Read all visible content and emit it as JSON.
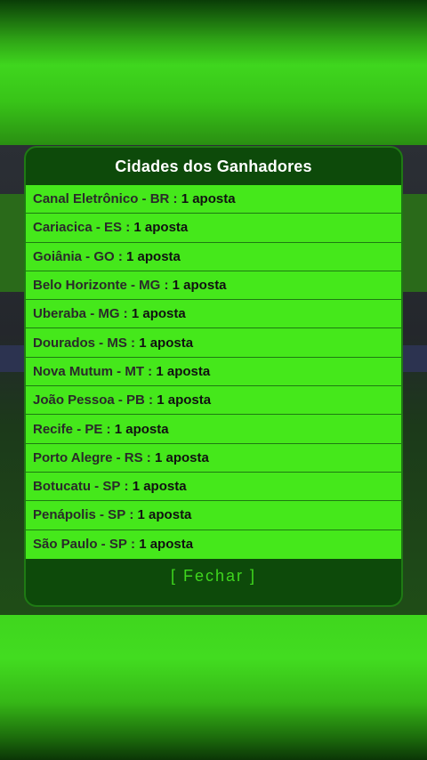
{
  "modal": {
    "title": "Cidades dos Ganhadores",
    "winners": [
      {
        "city": "Canal Eletrônico - BR",
        "count": "1 aposta"
      },
      {
        "city": "Cariacica - ES",
        "count": "1 aposta"
      },
      {
        "city": "Goiânia - GO",
        "count": "1 aposta"
      },
      {
        "city": "Belo Horizonte - MG",
        "count": "1 aposta"
      },
      {
        "city": "Uberaba - MG",
        "count": "1 aposta"
      },
      {
        "city": "Dourados - MS",
        "count": "1 aposta"
      },
      {
        "city": "Nova Mutum - MT",
        "count": "1 aposta"
      },
      {
        "city": "João Pessoa - PB",
        "count": "1 aposta"
      },
      {
        "city": "Recife - PE",
        "count": "1 aposta"
      },
      {
        "city": "Porto Alegre - RS",
        "count": "1 aposta"
      },
      {
        "city": "Botucatu - SP",
        "count": "1 aposta"
      },
      {
        "city": "Penápolis - SP",
        "count": "1 aposta"
      },
      {
        "city": "São Paulo - SP",
        "count": "1 aposta"
      }
    ],
    "separator": " : ",
    "close_label": "[ Fechar ]"
  },
  "colors": {
    "modal_bg": "#0d4a0a",
    "row_bg": "#45e81b",
    "close_text": "#3fd61e"
  }
}
